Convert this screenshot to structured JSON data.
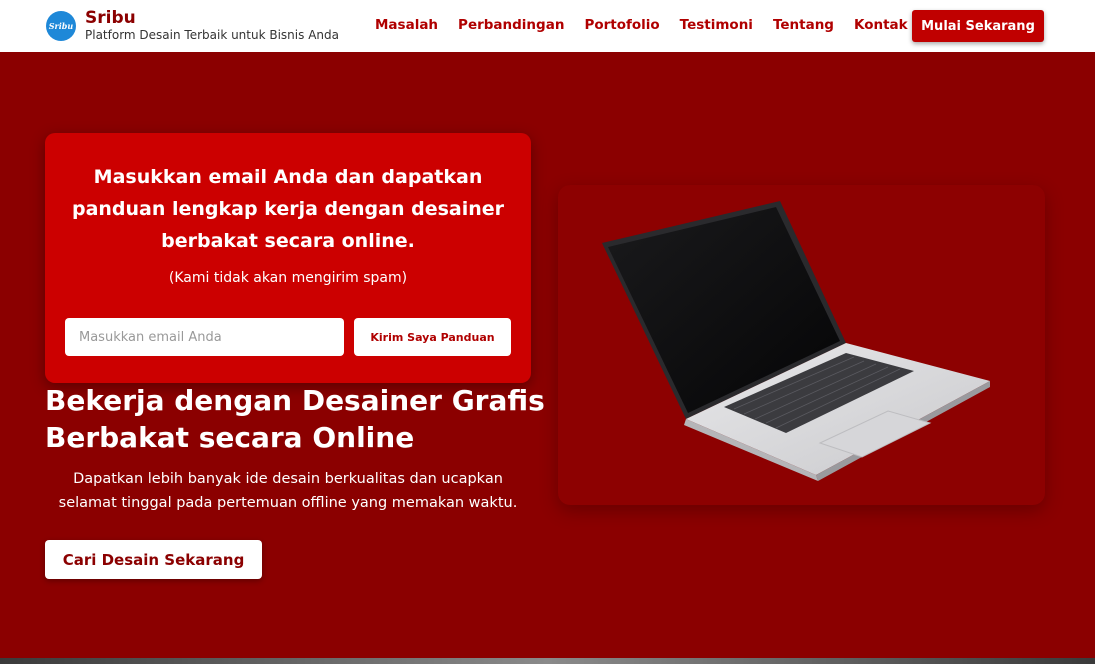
{
  "header": {
    "logo_text": "Sribu",
    "brand_name": "Sribu",
    "tagline": "Platform Desain Terbaik untuk Bisnis Anda",
    "nav": [
      {
        "label": "Masalah"
      },
      {
        "label": "Perbandingan"
      },
      {
        "label": "Portofolio"
      },
      {
        "label": "Testimoni"
      },
      {
        "label": "Tentang"
      },
      {
        "label": "Kontak"
      }
    ],
    "cta_label": "Mulai Sekarang"
  },
  "form": {
    "heading": "Masukkan email Anda dan dapatkan panduan lengkap kerja dengan desainer berbakat secara online.",
    "note": "(Kami tidak akan mengirim spam)",
    "email_placeholder": "Masukkan email Anda",
    "email_value": "",
    "submit_label": "Kirim Saya Panduan"
  },
  "hero": {
    "title": "Bekerja dengan Desainer Grafis Berbakat secara Online",
    "subtitle": "Dapatkan lebih banyak ide desain berkualitas dan ucapkan selamat tinggal pada pertemuan offline yang memakan waktu.",
    "cta_label": "Cari Desain Sekarang"
  },
  "colors": {
    "background": "#8b0000",
    "card": "#cc0000",
    "accent": "#c00000",
    "logo": "#1e88d8"
  },
  "icons": {
    "logo": "sribu-logo-icon",
    "hero_image": "laptop-icon"
  }
}
